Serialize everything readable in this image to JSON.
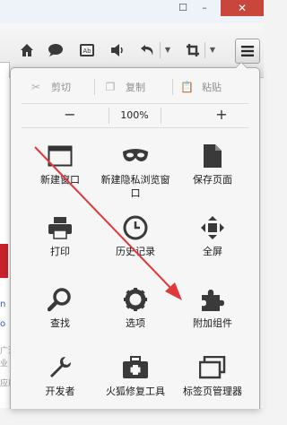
{
  "menu": {
    "edit": {
      "cut": "剪切",
      "copy": "复制",
      "paste": "粘贴"
    },
    "zoom": {
      "decrease": "−",
      "level": "100%",
      "increase": "+"
    },
    "items": [
      {
        "label": "新建窗口",
        "icon": "window-icon"
      },
      {
        "label": "新建隐私浏览窗口",
        "icon": "private-mask-icon"
      },
      {
        "label": "保存页面",
        "icon": "save-page-icon"
      },
      {
        "label": "打印",
        "icon": "printer-icon"
      },
      {
        "label": "历史记录",
        "icon": "history-clock-icon"
      },
      {
        "label": "全屏",
        "icon": "fullscreen-icon"
      },
      {
        "label": "查找",
        "icon": "magnifier-icon"
      },
      {
        "label": "选项",
        "icon": "gear-icon"
      },
      {
        "label": "附加组件",
        "icon": "puzzle-icon"
      },
      {
        "label": "开发者",
        "icon": "wrench-icon"
      },
      {
        "label": "火狐修复工具",
        "icon": "toolbox-icon"
      },
      {
        "label": "标签页管理器",
        "icon": "tab-manager-icon"
      }
    ]
  },
  "background_page": {
    "partial_link_1": "n",
    "partial_link_2": "o",
    "partial_text_1": "广泛",
    "partial_text_2": "业",
    "partial_text_3": "应用"
  },
  "colors": {
    "annotation_arrow": "#e0383b",
    "window_close": "#c9463d"
  }
}
